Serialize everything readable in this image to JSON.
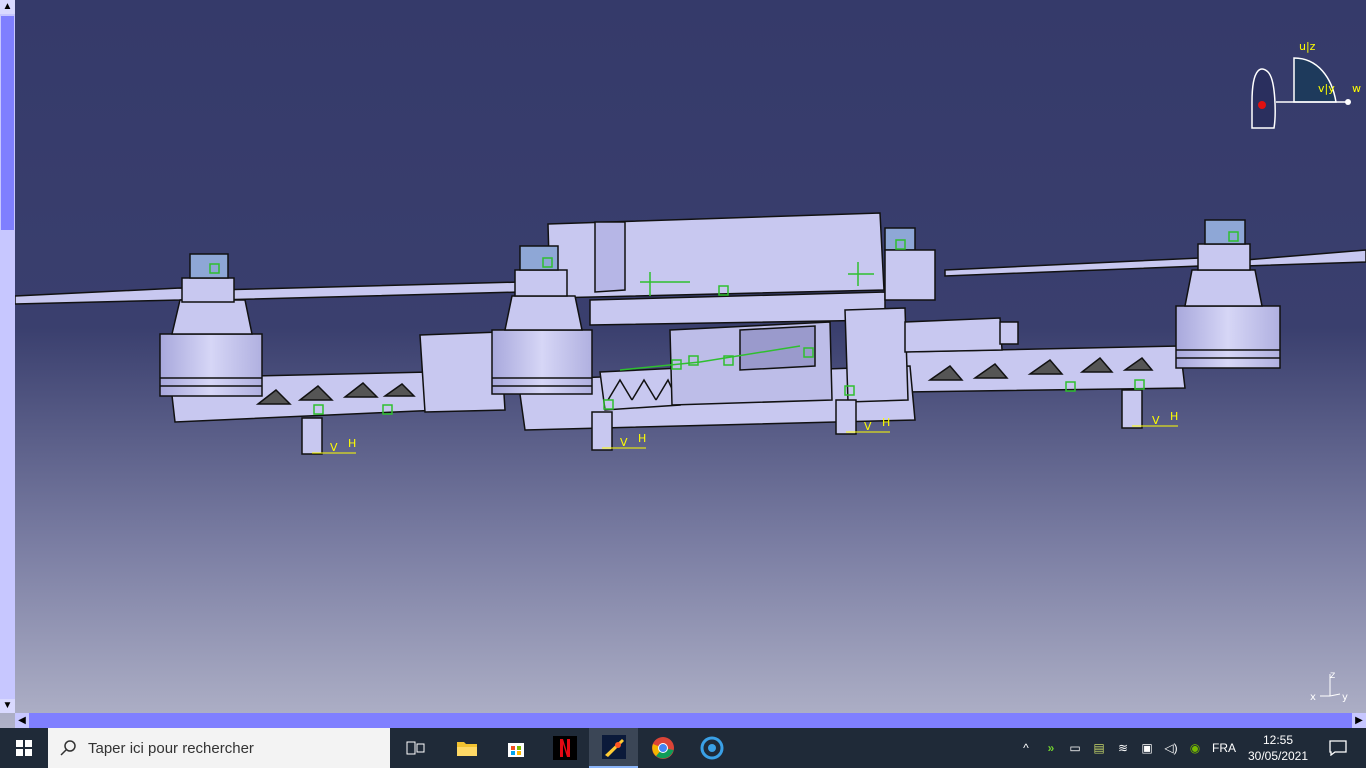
{
  "viewport": {
    "compass": {
      "u_z": "u|z",
      "v_y": "v|y",
      "w": "w"
    },
    "axis_triad": {
      "x": "x",
      "y": "y",
      "z": "z"
    },
    "constraint_labels": [
      "V",
      "H",
      "V",
      "H",
      "V",
      "H",
      "V",
      "H"
    ],
    "colors": {
      "background_top": "#353a6a",
      "background_bottom": "#b0b2c8",
      "part": "#c8c8f0",
      "constraint": "#2fbf2f",
      "axis_label": "#ffff00"
    }
  },
  "scrollbars": {
    "up": "▲",
    "down": "▼",
    "left": "◀",
    "right": "▶"
  },
  "taskbar": {
    "search_placeholder": "Taper ici pour rechercher",
    "apps": [
      "task-view",
      "file-explorer",
      "microsoft-store",
      "netflix",
      "catia",
      "chrome",
      "settings"
    ],
    "language": "FRA",
    "time": "12:55",
    "date": "30/05/2021"
  }
}
